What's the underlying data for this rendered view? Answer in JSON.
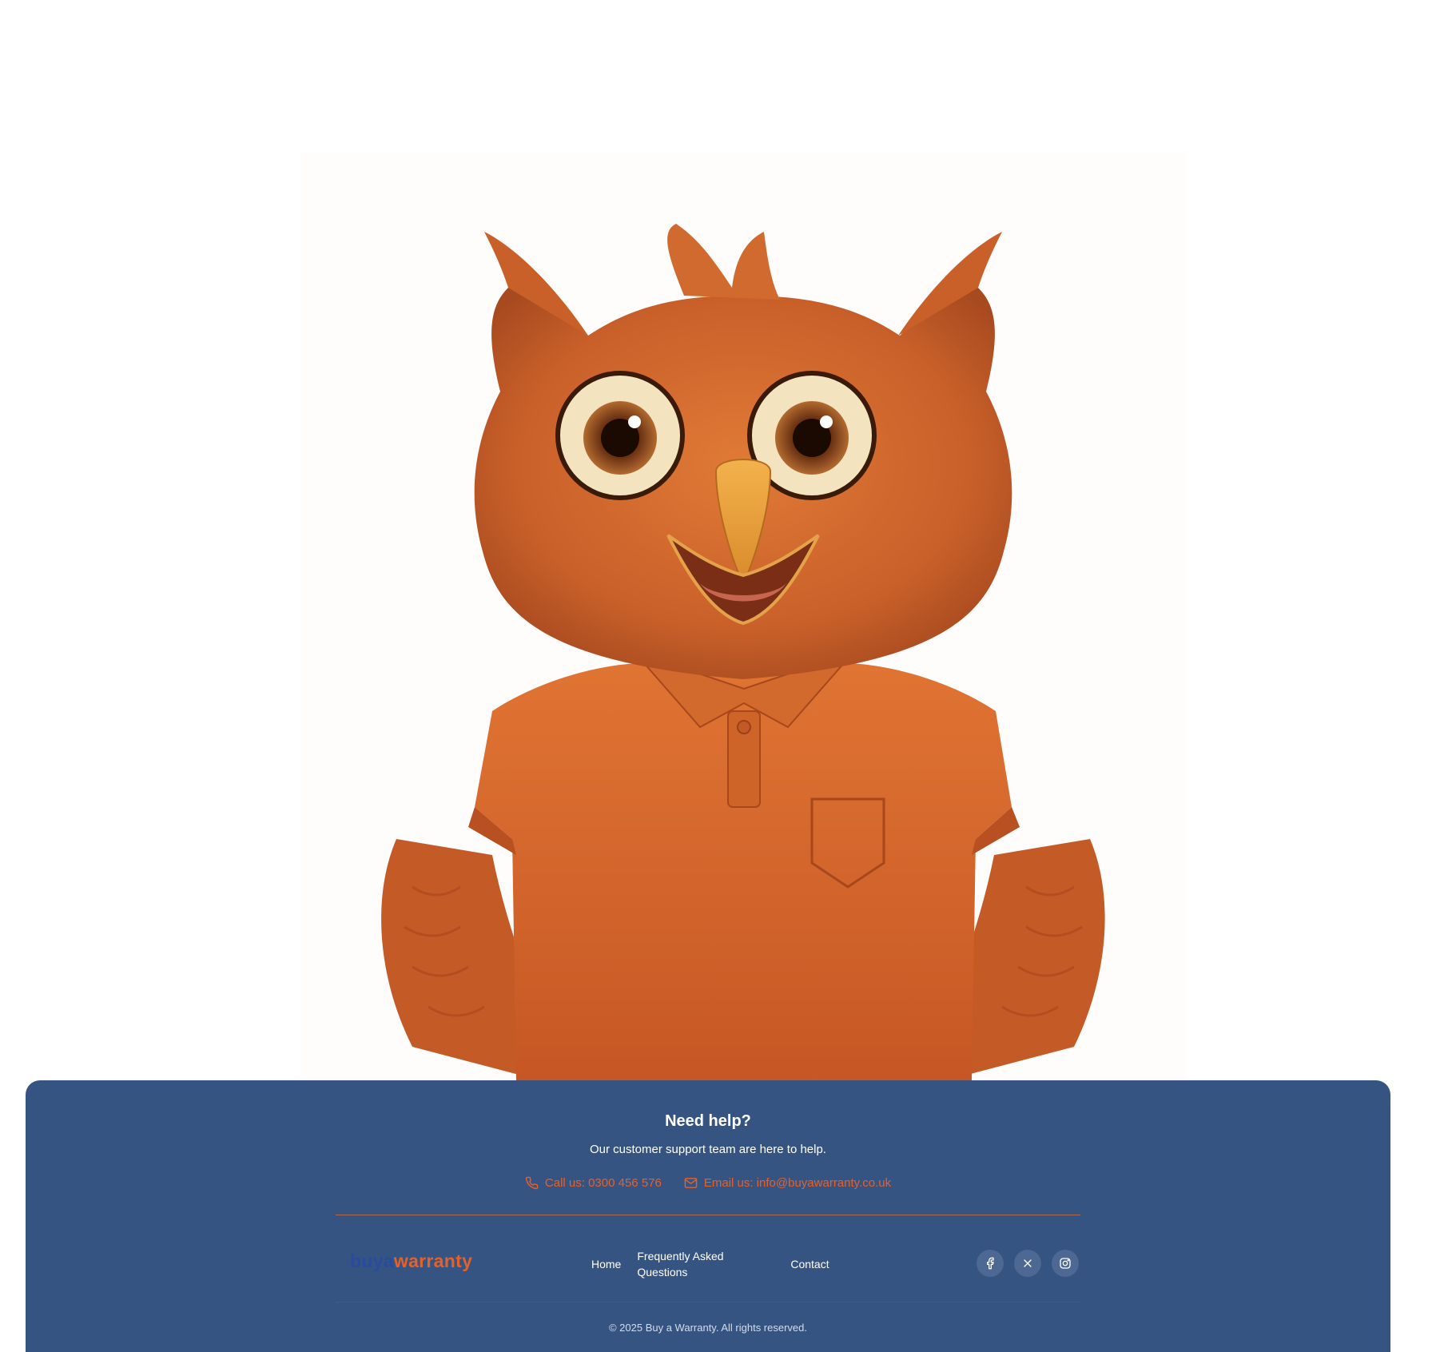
{
  "mascot": {
    "alt": "Orange owl mascot wearing polo shirt"
  },
  "footer": {
    "help_title": "Need help?",
    "help_subtitle": "Our customer support team are here to help.",
    "phone_label": "Call us: 0300 456 576",
    "email_label": "Email us: info@buyawarranty.co.uk",
    "logo_part1": "buya",
    "logo_part2": "warranty",
    "nav": {
      "home": "Home",
      "faq": "Frequently Asked Questions",
      "contact": "Contact"
    },
    "socials": [
      "facebook-icon",
      "x-icon",
      "instagram-icon"
    ],
    "copyright": "© 2025 Buy a Warranty. All rights reserved."
  },
  "colors": {
    "footer_bg": "#365482",
    "accent": "#e5612a",
    "logo_blue": "#284c9b",
    "mascot_orange": "#d7692a"
  }
}
